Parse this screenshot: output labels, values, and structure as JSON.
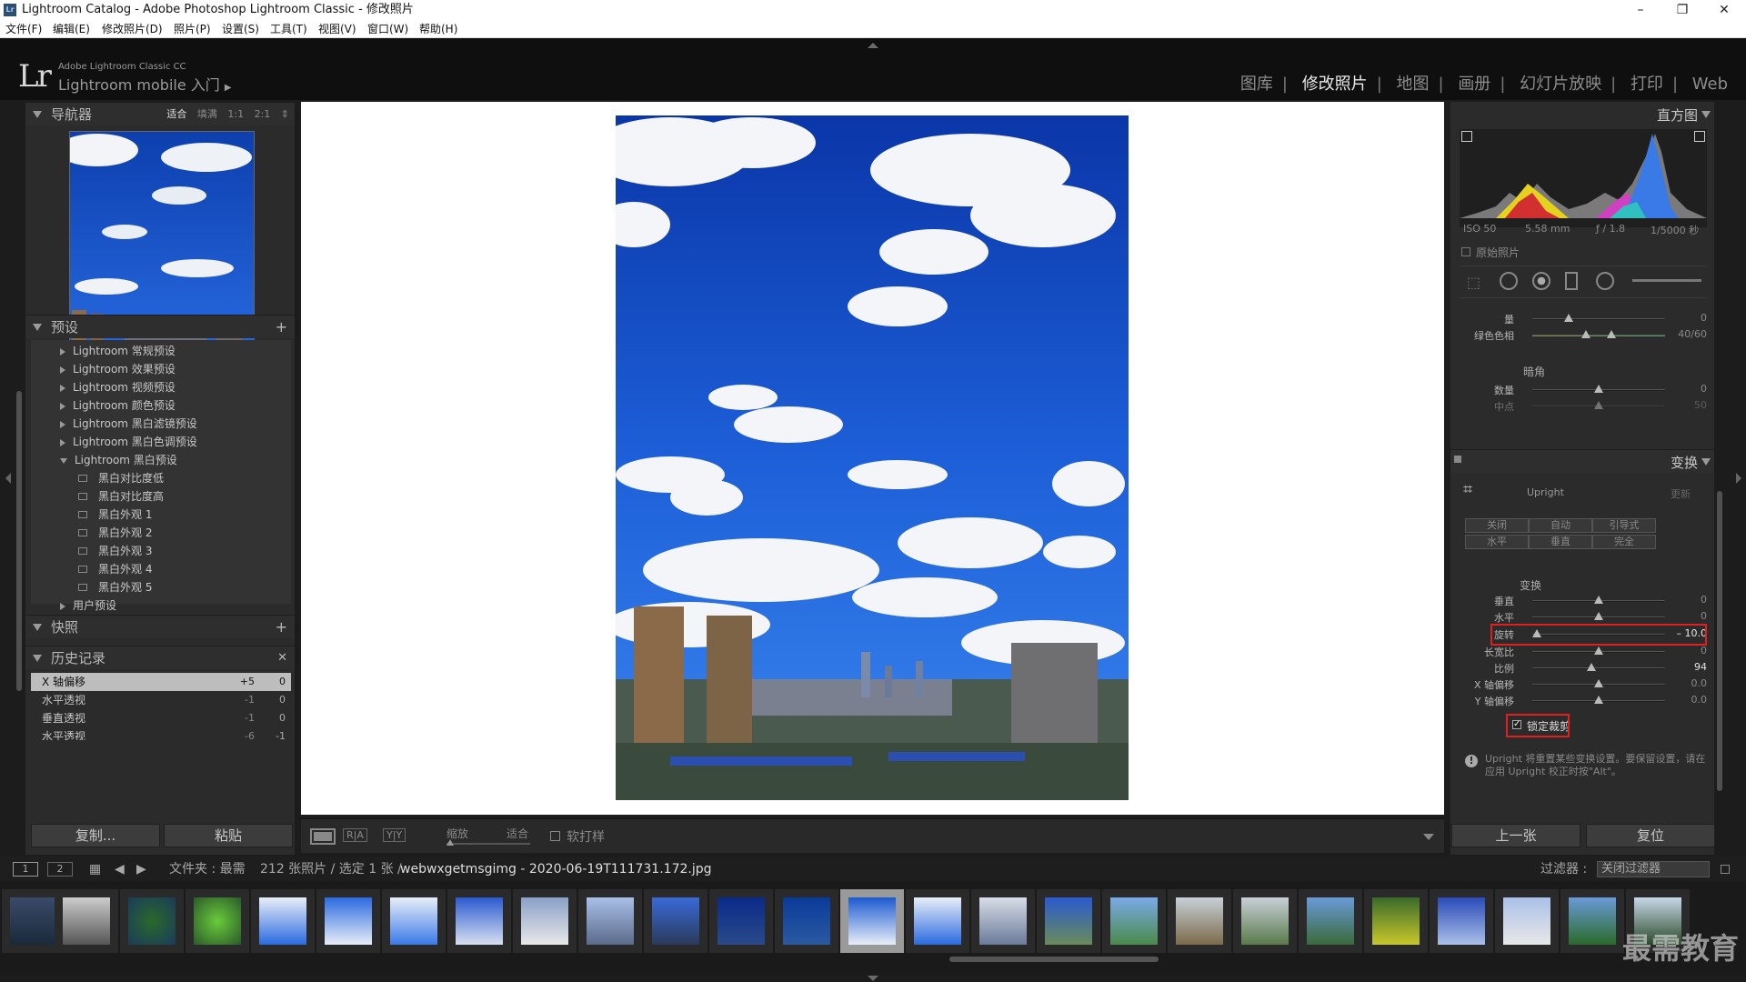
{
  "window": {
    "title": "Lightroom Catalog - Adobe Photoshop Lightroom Classic - 修改照片",
    "icon": "Lr",
    "minimize": "–",
    "maximize": "❐",
    "close": "✕"
  },
  "menu": [
    "文件(F)",
    "编辑(E)",
    "修改照片(D)",
    "照片(P)",
    "设置(S)",
    "工具(T)",
    "视图(V)",
    "窗口(W)",
    "帮助(H)"
  ],
  "identity": {
    "logo": "Lr",
    "product": "Adobe Lightroom Classic CC",
    "mobile": "Lightroom mobile 入门"
  },
  "modules": [
    {
      "label": "图库",
      "active": false
    },
    {
      "label": "修改照片",
      "active": true
    },
    {
      "label": "地图",
      "active": false
    },
    {
      "label": "画册",
      "active": false
    },
    {
      "label": "幻灯片放映",
      "active": false
    },
    {
      "label": "打印",
      "active": false
    },
    {
      "label": "Web",
      "active": false
    }
  ],
  "left": {
    "navigator": {
      "title": "导航器",
      "options": [
        "适合",
        "填满",
        "1:1",
        "2:1"
      ]
    },
    "presets": {
      "title": "预设",
      "add": "+",
      "groups": [
        "Lightroom 常规预设",
        "Lightroom 效果预设",
        "Lightroom 视频预设",
        "Lightroom 颜色预设",
        "Lightroom 黑白滤镜预设",
        "Lightroom 黑白色调预设",
        "Lightroom 黑白预设"
      ],
      "items": [
        "黑白对比度低",
        "黑白对比度高",
        "黑白外观 1",
        "黑白外观 2",
        "黑白外观 3",
        "黑白外观 4",
        "黑白外观 5"
      ],
      "user": "用户预设"
    },
    "snapshots": {
      "title": "快照",
      "add": "+"
    },
    "history": {
      "title": "历史记录",
      "close": "✕",
      "rows": [
        {
          "label": "X 轴偏移",
          "a": "+5",
          "b": "0"
        },
        {
          "label": "水平透视",
          "a": "-1",
          "b": "0"
        },
        {
          "label": "垂直透视",
          "a": "-1",
          "b": "0"
        },
        {
          "label": "水平透视",
          "a": "-6",
          "b": "-1"
        }
      ]
    },
    "copy": "复制...",
    "paste": "粘贴"
  },
  "toolbar": {
    "zoom_label": "缩放",
    "zoom_value": "适合",
    "softproof": "软打样",
    "ra": "R|A",
    "yy": "Y|Y"
  },
  "right": {
    "histogram": {
      "title": "直方图",
      "iso": "ISO 50",
      "focal": "5.58 mm",
      "aperture": "ƒ / 1.8",
      "shutter": "1/5000 秒",
      "original": "原始照片"
    },
    "partial": [
      {
        "label": "量",
        "value": "0",
        "pos": 0.03
      },
      {
        "label": "绿色色相",
        "value": "40/60",
        "pos": 0.4
      }
    ],
    "vignette": {
      "title": "暗角",
      "sliders": [
        {
          "label": "数量",
          "value": "0",
          "pos": 0.5
        },
        {
          "label": "中点",
          "value": "50",
          "pos": 0.5
        }
      ]
    },
    "transform": {
      "title": "变换",
      "upright": "Upright",
      "update": "更新",
      "buttons": [
        "关闭",
        "自动",
        "引导式",
        "水平",
        "垂直",
        "完全"
      ],
      "section": "变换",
      "sliders": [
        {
          "label": "垂直",
          "value": "0",
          "pos": 0.5
        },
        {
          "label": "水平",
          "value": "0",
          "pos": 0.5
        },
        {
          "label": "旋转",
          "value": "– 10.0",
          "pos": 0.03
        },
        {
          "label": "长宽比",
          "value": "0",
          "pos": 0.5
        },
        {
          "label": "比例",
          "value": "94",
          "pos": 0.45
        },
        {
          "label": "X 轴偏移",
          "value": "0.0",
          "pos": 0.5
        },
        {
          "label": "Y 轴偏移",
          "value": "0.0",
          "pos": 0.5
        }
      ],
      "lock": "锁定裁剪",
      "note": "Upright 将重置某些变换设置。要保留设置，请在应用 Upright 校正时按\"Alt\"。"
    },
    "prev": "上一张",
    "reset": "复位"
  },
  "filmbar": {
    "view1": "1",
    "view2": "2",
    "folder": "文件夹 : 最需",
    "count": "212 张照片 / 选定 1 张 /",
    "file": "webwxgetmsgimg - 2020-06-19T111731.172.jpg",
    "filter_label": "过滤器 :",
    "filter_value": "关闭过滤器"
  },
  "watermark": "最需教育"
}
